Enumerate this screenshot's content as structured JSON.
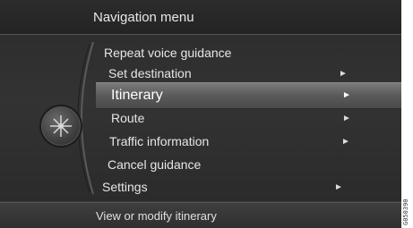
{
  "header": {
    "title": "Navigation menu"
  },
  "menu": {
    "items": [
      {
        "label": "Repeat voice guidance",
        "has_submenu": false
      },
      {
        "label": "Set destination",
        "has_submenu": true
      },
      {
        "label": "Itinerary",
        "has_submenu": true,
        "selected": true
      },
      {
        "label": "Route",
        "has_submenu": true
      },
      {
        "label": "Traffic information",
        "has_submenu": true
      },
      {
        "label": "Cancel guidance",
        "has_submenu": false
      },
      {
        "label": "Settings",
        "has_submenu": true
      }
    ],
    "arrow_glyph": "►"
  },
  "status_bar": {
    "text": "View or modify itinerary"
  },
  "figure_code": "G050390",
  "colors": {
    "background": "#3a3a3a",
    "highlight": "#6a6a6a",
    "text": "#e6e6e6"
  },
  "icons": {
    "knob": "compass-knob-icon"
  }
}
